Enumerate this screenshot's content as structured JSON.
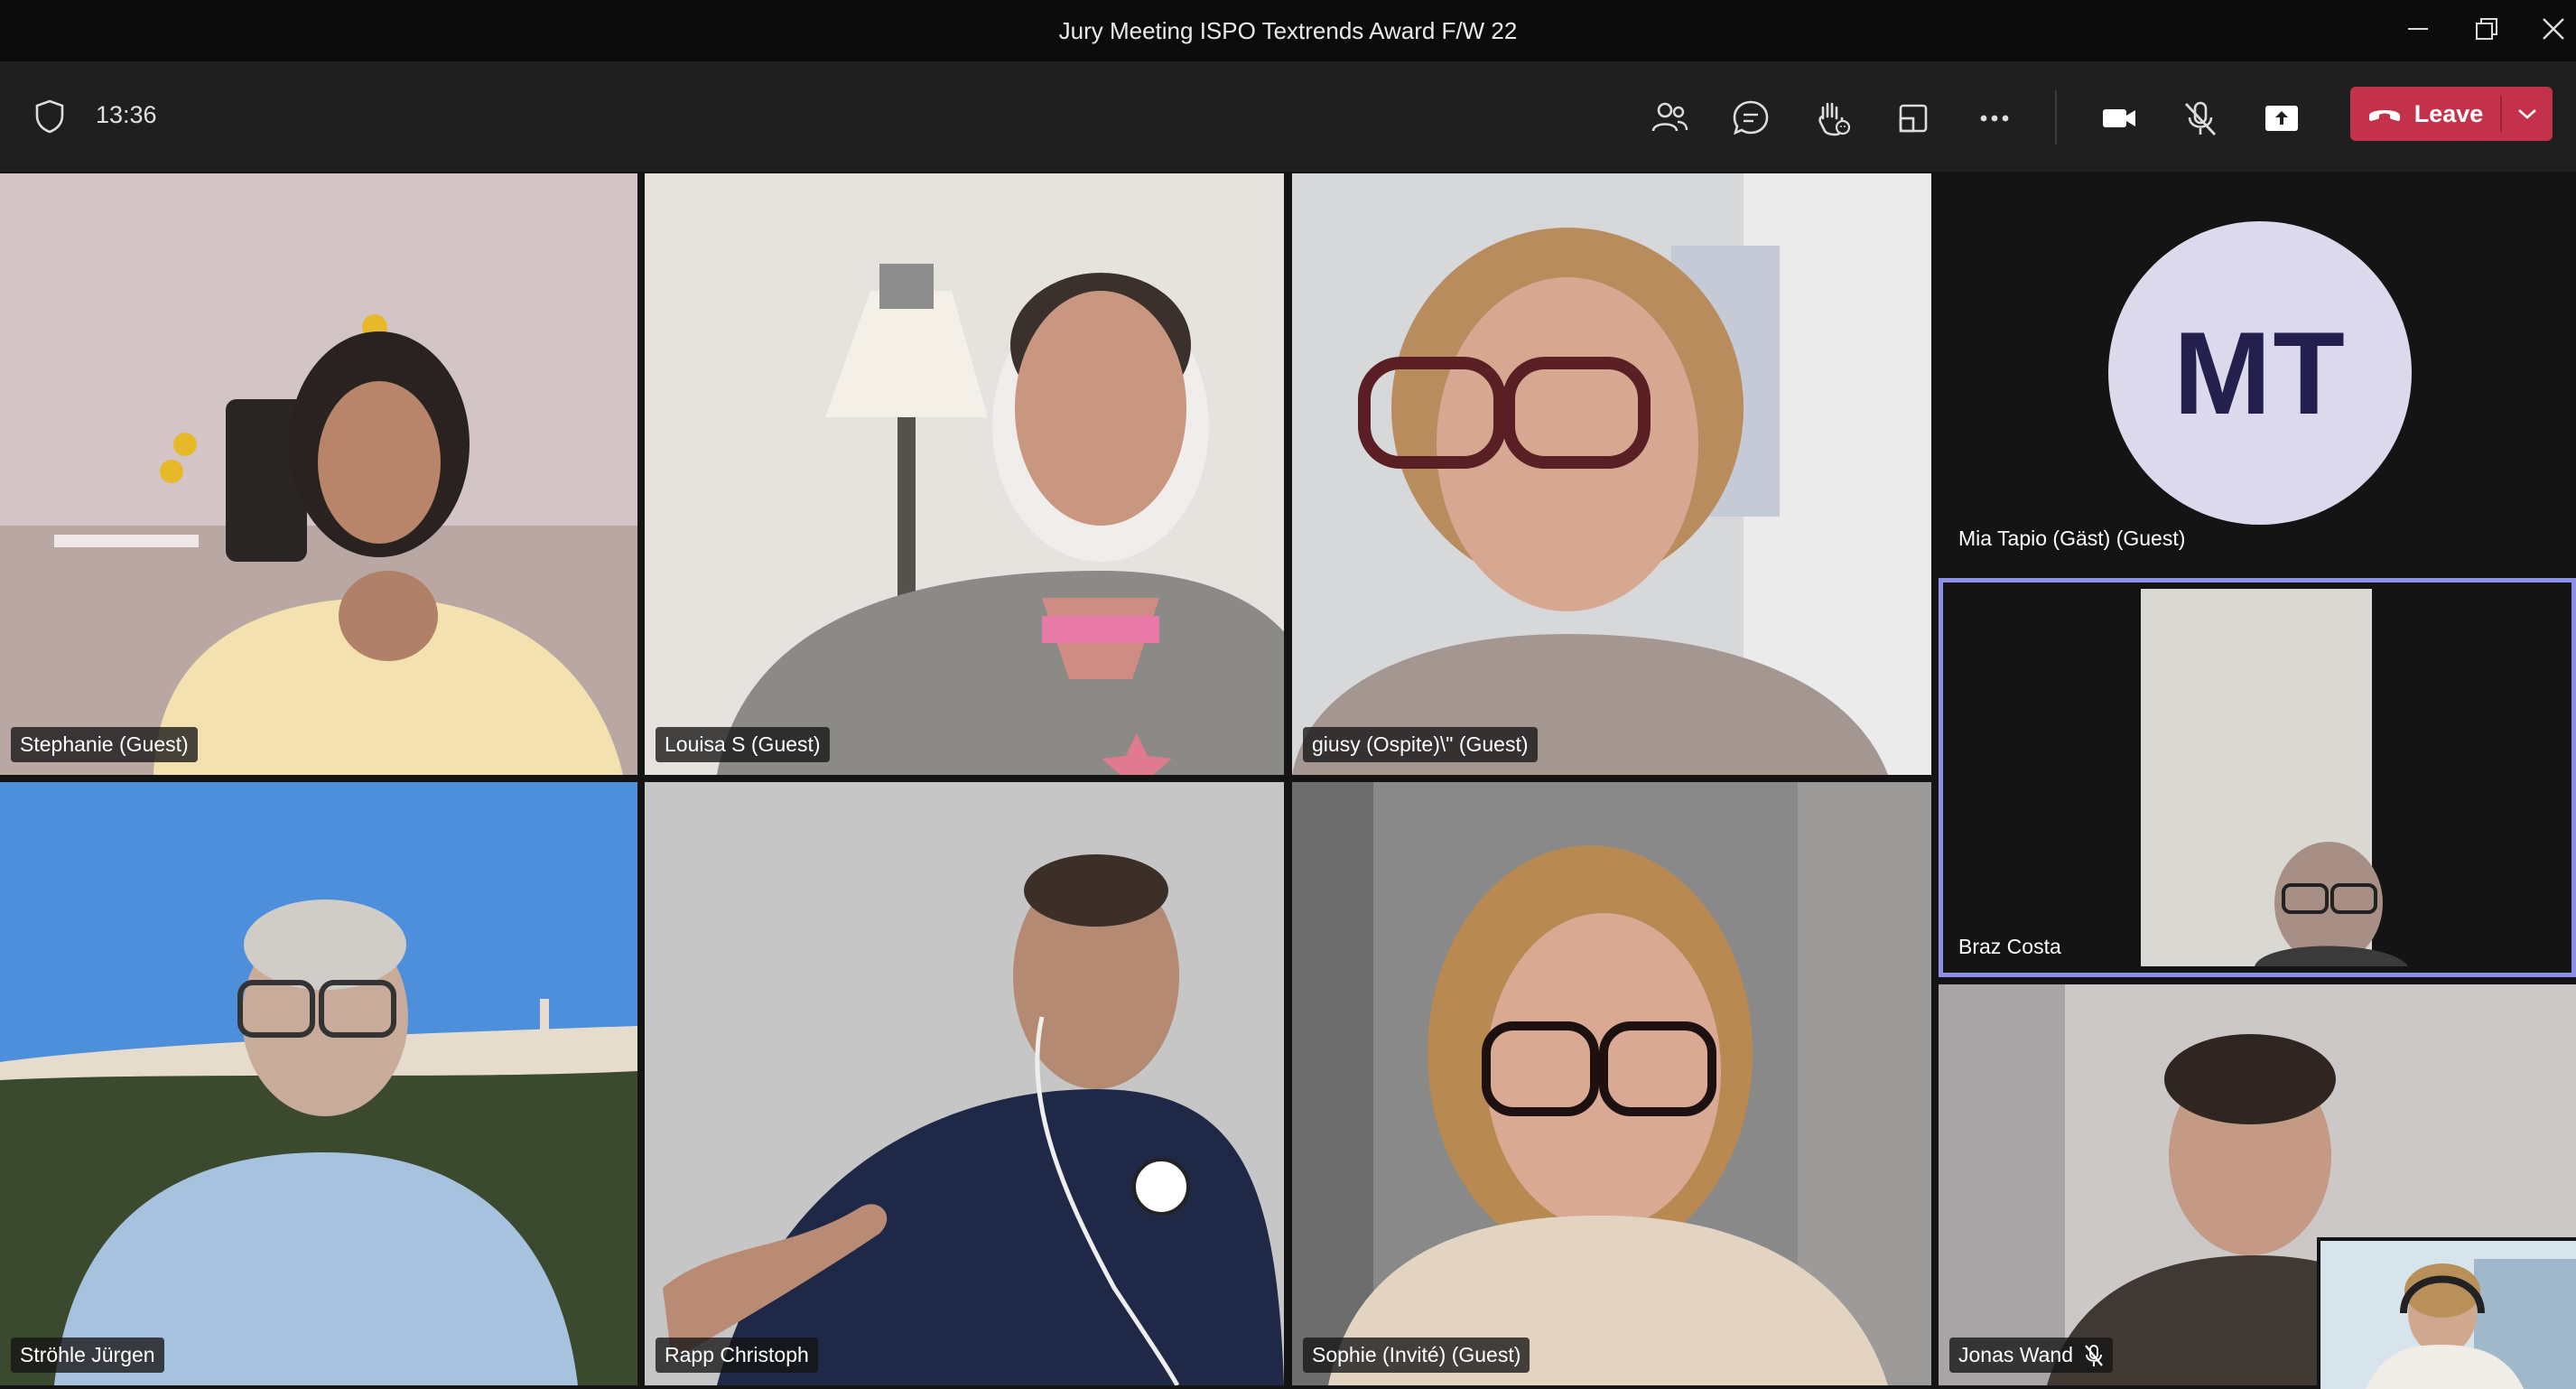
{
  "window": {
    "title": "Jury Meeting ISPO Textrends Award F/W 22"
  },
  "toolbar": {
    "time": "13:36",
    "leave_label": "Leave"
  },
  "participants": [
    {
      "name": "Stephanie (Guest)"
    },
    {
      "name": "Louisa S (Guest)"
    },
    {
      "name": "giusy (Ospite)\\\" (Guest)"
    },
    {
      "name": "Mia Tapio (Gäst) (Guest)",
      "initials": "MT"
    },
    {
      "name": "Braz Costa"
    },
    {
      "name": "Ströhle Jürgen"
    },
    {
      "name": "Rapp Christoph"
    },
    {
      "name": "Sophie (Invité) (Guest)"
    },
    {
      "name": "Jonas Wand",
      "muted": true
    }
  ],
  "colors": {
    "leave": "#c4314b",
    "active_speaker": "#8e8fe8",
    "avatar_bg": "#dcd9ec",
    "avatar_text": "#23204e"
  }
}
